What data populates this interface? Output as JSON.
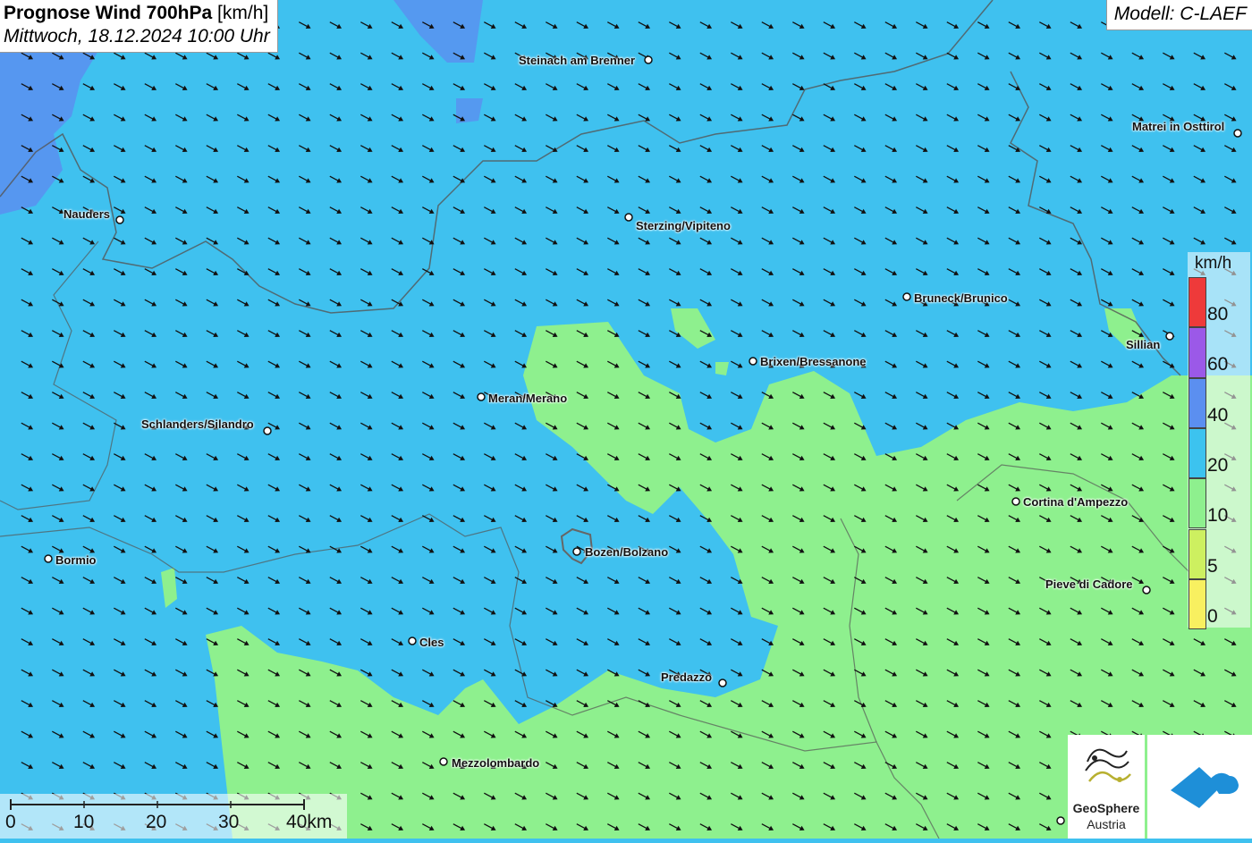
{
  "header": {
    "title_bold": "Prognose Wind 700hPa",
    "title_unit": "[km/h]",
    "datetime": "Mittwoch, 18.12.2024 10:00 Uhr",
    "model": "Modell: C-LAEF"
  },
  "legend": {
    "unit": "km/h",
    "levels": [
      {
        "label": "80",
        "color": "#ee3a3a"
      },
      {
        "label": "60",
        "color": "#9b59e8"
      },
      {
        "label": "40",
        "color": "#5b8ff0"
      },
      {
        "label": "20",
        "color": "#3cc3ef"
      },
      {
        "label": "10",
        "color": "#8ef08e"
      },
      {
        "label": "5",
        "color": "#cdf060"
      },
      {
        "label": "0",
        "color": "#f8f060"
      }
    ],
    "top_color": "#ee3a3a"
  },
  "scalebar": {
    "ticks": [
      "0",
      "10",
      "20",
      "30",
      "40km"
    ]
  },
  "cities": [
    {
      "name": "Steinach am Brenner"
    },
    {
      "name": "Matrei in Osttirol"
    },
    {
      "name": "Nauders"
    },
    {
      "name": "Sterzing/Vipiteno"
    },
    {
      "name": "Bruneck/Brunico"
    },
    {
      "name": "Sillian"
    },
    {
      "name": "Brixen/Bressanone"
    },
    {
      "name": "Meran/Merano"
    },
    {
      "name": "Schlanders/Silandro"
    },
    {
      "name": "Cortina d'Ampezzo"
    },
    {
      "name": "Bozen/Bolzano"
    },
    {
      "name": "Bormio"
    },
    {
      "name": "Pieve di Cadore"
    },
    {
      "name": "Cles"
    },
    {
      "name": "Predazzo"
    },
    {
      "name": "Mezzolombardo"
    }
  ],
  "logos": {
    "geosphere_line1": "GeoSphere",
    "geosphere_line2": "Austria"
  },
  "colors": {
    "wind_20_40": "#3fc1ef",
    "wind_10_20": "#8ef08e",
    "wind_40_60": "#5b8ff0",
    "arrow": "#111111"
  }
}
